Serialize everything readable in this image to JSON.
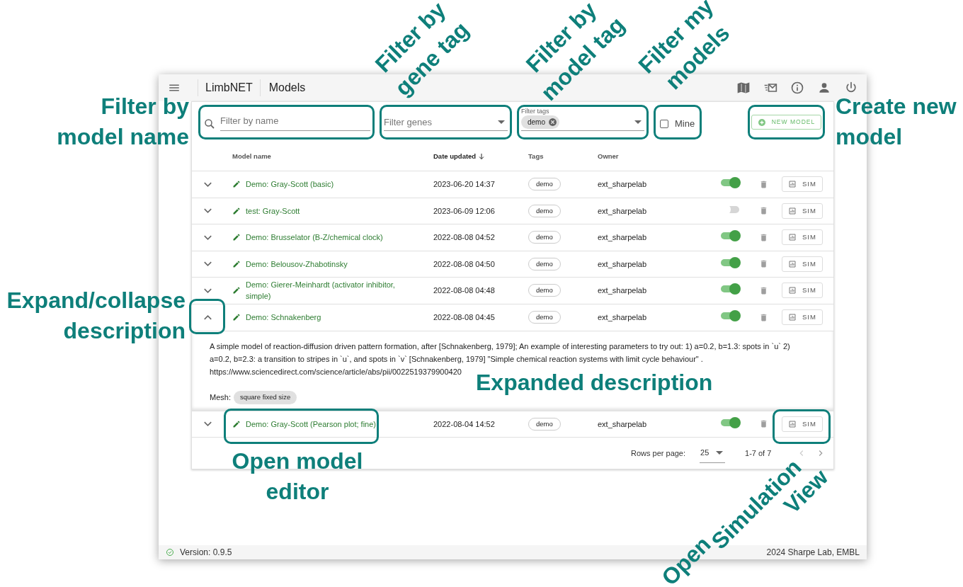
{
  "app": {
    "title": "LimbNET",
    "page": "Models"
  },
  "filters": {
    "name_placeholder": "Filter by name",
    "genes_placeholder": "Filter genes",
    "tags_label": "Filter tags",
    "tags": [
      {
        "label": "demo"
      }
    ],
    "mine": {
      "label": "Mine",
      "checked": false
    },
    "new_button": "NEW MODEL"
  },
  "table": {
    "columns": [
      {
        "label": "Model name",
        "sorted": false
      },
      {
        "label": "Date updated",
        "sorted": true
      },
      {
        "label": "Tags",
        "sorted": false
      },
      {
        "label": "Owner",
        "sorted": false
      }
    ],
    "rows": [
      {
        "name": "Demo: Gray-Scott (basic)",
        "date": "2023-06-20 14:37",
        "tags": [
          "demo"
        ],
        "owner": "ext_sharpelab",
        "public": true,
        "expanded": false,
        "sim": "SIM"
      },
      {
        "name": "test: Gray-Scott",
        "date": "2023-06-09 12:06",
        "tags": [
          "demo"
        ],
        "owner": "ext_sharpelab",
        "public": false,
        "expanded": false,
        "sim": "SIM"
      },
      {
        "name": "Demo: Brusselator (B-Z/chemical clock)",
        "date": "2022-08-08 04:52",
        "tags": [
          "demo"
        ],
        "owner": "ext_sharpelab",
        "public": true,
        "expanded": false,
        "sim": "SIM"
      },
      {
        "name": "Demo: Belousov-Zhabotinsky",
        "date": "2022-08-08 04:50",
        "tags": [
          "demo"
        ],
        "owner": "ext_sharpelab",
        "public": true,
        "expanded": false,
        "sim": "SIM"
      },
      {
        "name": "Demo: Gierer-Meinhardt (activator inhibitor, simple)",
        "date": "2022-08-08 04:48",
        "tags": [
          "demo"
        ],
        "owner": "ext_sharpelab",
        "public": true,
        "expanded": false,
        "sim": "SIM"
      },
      {
        "name": "Demo: Schnakenberg",
        "date": "2022-08-08 04:45",
        "tags": [
          "demo"
        ],
        "owner": "ext_sharpelab",
        "public": true,
        "expanded": true,
        "sim": "SIM",
        "description": "A simple model of reaction-diffusion driven pattern formation, after [Schnakenberg, 1979]; An example of interesting parameters to try out: 1) a=0.2, b=1.3: spots in `u` 2) a=0.2, b=2.3: a transition to stripes in `u`, and spots in `v` [Schnakenberg, 1979] \"Simple chemical reaction systems with limit cycle behaviour\" . https://www.sciencedirect.com/science/article/abs/pii/0022519379900420",
        "mesh_label": "Mesh:",
        "mesh": "square fixed size"
      },
      {
        "name": "Demo: Gray-Scott (Pearson plot; fine)",
        "date": "2022-08-04 14:52",
        "tags": [
          "demo"
        ],
        "owner": "ext_sharpelab",
        "public": true,
        "expanded": false,
        "sim": "SIM"
      }
    ]
  },
  "pagination": {
    "rows_per_page_label": "Rows per page:",
    "rows_per_page": "25",
    "range": "1-7 of 7"
  },
  "status_bar": {
    "version": "Version: 0.9.5",
    "credit": "2024 Sharpe Lab, EMBL"
  },
  "annotations": [
    {
      "text": "Filter by\nmodel name"
    },
    {
      "text": "Filter by\ngene tag"
    },
    {
      "text": "Filter by\nmodel tag"
    },
    {
      "text": "Filter my\nmodels"
    },
    {
      "text": "Create new\nmodel"
    },
    {
      "text": "Expand/collapse\ndescription"
    },
    {
      "text": "Expanded description"
    },
    {
      "text": "Open model\neditor"
    },
    {
      "text": "Open"
    },
    {
      "text": "Simulation"
    },
    {
      "text": "View"
    }
  ]
}
